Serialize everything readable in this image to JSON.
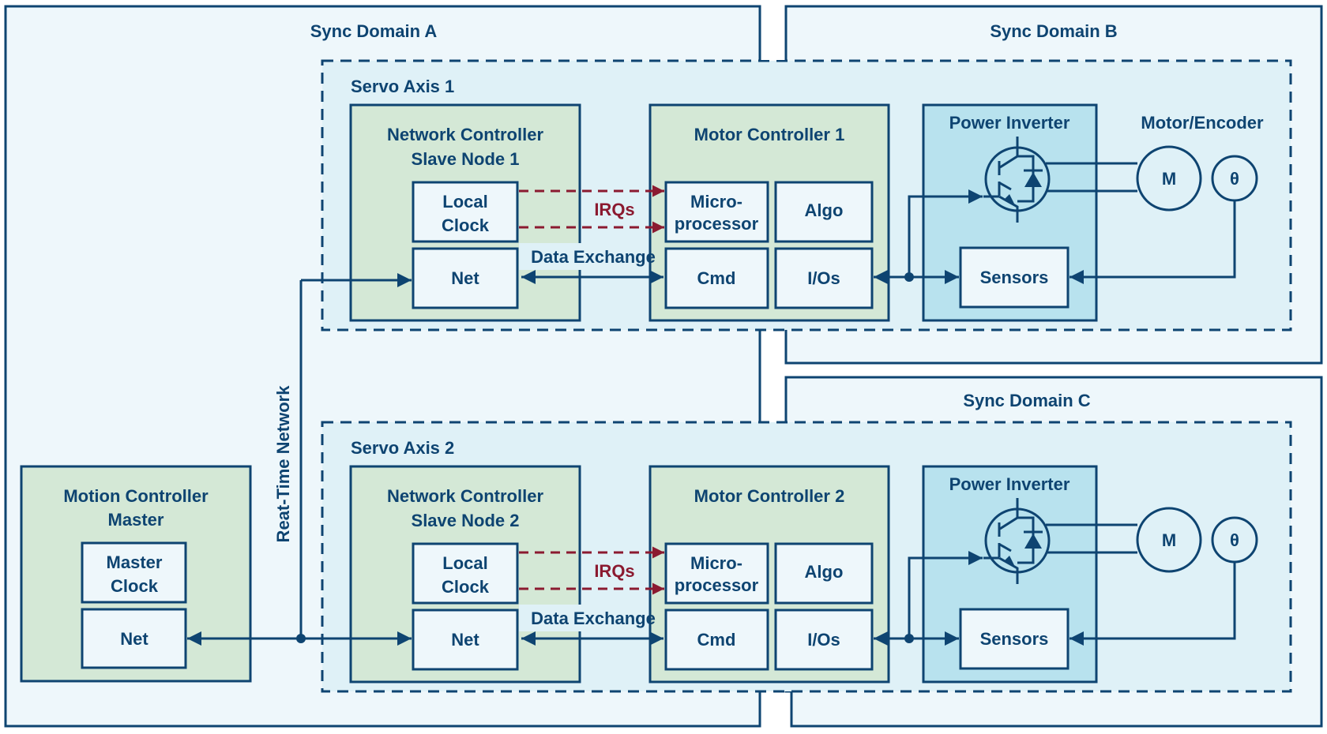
{
  "domains": {
    "a": {
      "label": "Sync Domain A"
    },
    "b": {
      "label": "Sync Domain B"
    },
    "c": {
      "label": "Sync Domain C"
    }
  },
  "network": {
    "label": "Reat-Time Network"
  },
  "motion_controller": {
    "title_line1": "Motion Controller",
    "title_line2": "Master",
    "clock_line1": "Master",
    "clock_line2": "Clock",
    "net": "Net"
  },
  "axes": [
    {
      "label": "Servo Axis 1",
      "network_controller": {
        "title_line1": "Network Controller",
        "title_line2": "Slave Node 1",
        "clock_line1": "Local",
        "clock_line2": "Clock",
        "net": "Net"
      },
      "irq_label": "IRQs",
      "data_exchange_label": "Data Exchange",
      "motor_controller": {
        "title": "Motor Controller 1",
        "micro_line1": "Micro-",
        "micro_line2": "processor",
        "algo": "Algo",
        "cmd": "Cmd",
        "ios": "I/Os"
      },
      "power_inverter": {
        "title": "Power Inverter",
        "sensors": "Sensors"
      },
      "motor_encoder_label": "Motor/Encoder",
      "motor_symbol": "M",
      "encoder_symbol": "θ"
    },
    {
      "label": "Servo Axis 2",
      "network_controller": {
        "title_line1": "Network Controller",
        "title_line2": "Slave Node 2",
        "clock_line1": "Local",
        "clock_line2": "Clock",
        "net": "Net"
      },
      "irq_label": "IRQs",
      "data_exchange_label": "Data Exchange",
      "motor_controller": {
        "title": "Motor Controller 2",
        "micro_line1": "Micro-",
        "micro_line2": "processor",
        "algo": "Algo",
        "cmd": "Cmd",
        "ios": "I/Os"
      },
      "power_inverter": {
        "title": "Power Inverter",
        "sensors": "Sensors"
      },
      "motor_encoder_label": "",
      "motor_symbol": "M",
      "encoder_symbol": "θ"
    }
  ],
  "colors": {
    "stroke": "#0e4471",
    "irq": "#8b1a30",
    "domain_bg": "#eef7fb",
    "axis_bg": "#dff1f7",
    "controller_bg": "#d4e8d6",
    "inverter_bg": "#b8e2ee"
  }
}
